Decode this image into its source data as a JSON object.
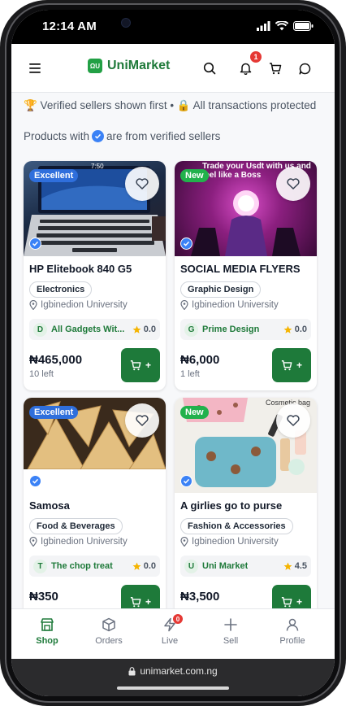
{
  "status": {
    "time": "12:14 AM"
  },
  "header": {
    "brand": "UniMarket",
    "logo_text": "ΩU",
    "notif_count": "1"
  },
  "notice": {
    "line1": "🏆 Verified sellers shown first • 🔒 All transactions protected",
    "line2_prefix": "Products with",
    "line2_suffix": "are from verified sellers"
  },
  "products": [
    {
      "condition": "Excellent",
      "name": "HP Elitebook 840 G5",
      "category": "Electronics",
      "location": "Igbinedion University",
      "seller_initial": "D",
      "seller": "All Gadgets Wit...",
      "rating": "0.0",
      "price": "₦465,000",
      "stock": "10 left",
      "img_text": "7:50"
    },
    {
      "condition": "New",
      "name": "SOCIAL MEDIA FLYERS",
      "category": "Graphic Design",
      "location": "Igbinedion University",
      "seller_initial": "G",
      "seller": "Prime Design",
      "rating": "0.0",
      "price": "₦6,000",
      "stock": "1 left",
      "img_text": "Trade your Usdt with us and feel like a Boss"
    },
    {
      "condition": "Excellent",
      "name": "Samosa",
      "category": "Food & Beverages",
      "location": "Igbinedion University",
      "seller_initial": "T",
      "seller": "The chop treat",
      "rating": "0.0",
      "price": "₦350",
      "stock": ""
    },
    {
      "condition": "New",
      "name": "A girlies go to purse",
      "category": "Fashion & Accessories",
      "location": "Igbinedion University",
      "seller_initial": "U",
      "seller": "Uni Market",
      "rating": "4.5",
      "price": "₦3,500",
      "stock": "",
      "img_text": "Cosmetic bag"
    }
  ],
  "cart_label": "+",
  "nav": [
    {
      "label": "Shop",
      "icon": "shop-icon"
    },
    {
      "label": "Orders",
      "icon": "box-icon"
    },
    {
      "label": "Live",
      "icon": "lightning-icon",
      "badge": "0"
    },
    {
      "label": "Sell",
      "icon": "plus-icon"
    },
    {
      "label": "Profile",
      "icon": "user-icon"
    }
  ],
  "browser": {
    "url": "unimarket.com.ng"
  },
  "colors": {
    "brand_green": "#1e7a3a",
    "verified_blue": "#3b82f6",
    "badge_red": "#e53935"
  }
}
